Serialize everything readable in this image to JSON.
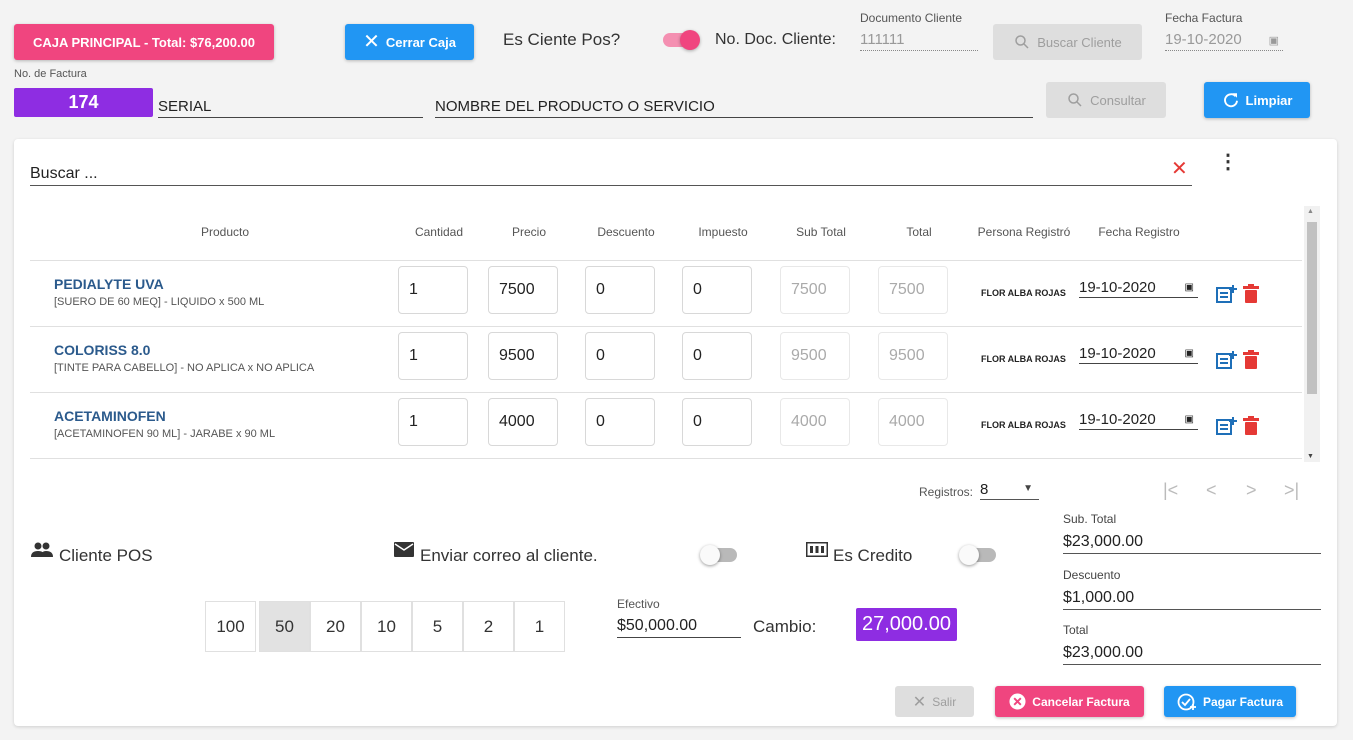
{
  "header": {
    "caja_label": "CAJA PRINCIPAL - Total: $76,200.00",
    "cerrar_caja": "Cerrar Caja",
    "es_cliente_pos": "Es Ciente Pos?",
    "no_doc_cliente": "No. Doc. Cliente:",
    "documento_cliente_label": "Documento Cliente",
    "documento_cliente_value": "111111",
    "buscar_cliente": "Buscar Cliente",
    "fecha_factura_label": "Fecha Factura",
    "fecha_factura_value": "19-10-2020",
    "no_factura_label": "No. de Factura",
    "no_factura_value": "174",
    "serial_placeholder": "SERIAL",
    "producto_placeholder": "NOMBRE DEL PRODUCTO O SERVICIO",
    "consultar": "Consultar",
    "limpiar": "Limpiar"
  },
  "table": {
    "search_placeholder": "Buscar ...",
    "columns": [
      "Producto",
      "Cantidad",
      "Precio",
      "Descuento",
      "Impuesto",
      "Sub Total",
      "Total",
      "Persona Registró",
      "Fecha Registro"
    ],
    "rows": [
      {
        "name": "PEDIALYTE UVA",
        "desc": "[SUERO DE 60 MEQ] - LIQUIDO x 500 ML",
        "cantidad": "1",
        "precio": "7500",
        "descuento": "0",
        "impuesto": "0",
        "subtotal": "7500",
        "total": "7500",
        "persona": "FLOR ALBA ROJAS",
        "fecha": "19-10-2020"
      },
      {
        "name": "COLORISS 8.0",
        "desc": "[TINTE PARA CABELLO] - NO APLICA x NO APLICA",
        "cantidad": "1",
        "precio": "9500",
        "descuento": "0",
        "impuesto": "0",
        "subtotal": "9500",
        "total": "9500",
        "persona": "FLOR ALBA ROJAS",
        "fecha": "19-10-2020"
      },
      {
        "name": "ACETAMINOFEN",
        "desc": "[ACETAMINOFEN 90 ML] - JARABE x 90 ML",
        "cantidad": "1",
        "precio": "4000",
        "descuento": "0",
        "impuesto": "0",
        "subtotal": "4000",
        "total": "4000",
        "persona": "FLOR ALBA ROJAS",
        "fecha": "19-10-2020"
      }
    ],
    "registros_label": "Registros:",
    "registros_value": "8"
  },
  "footer": {
    "cliente_pos": "Cliente POS",
    "enviar_correo": "Enviar correo al cliente.",
    "es_credito": "Es Credito",
    "coins": [
      "100",
      "50",
      "20",
      "10",
      "5",
      "2",
      "1"
    ],
    "efectivo_label": "Efectivo",
    "efectivo_value": "$50,000.00",
    "cambio_label": "Cambio:",
    "cambio_value": "27,000.00",
    "subtotal_label": "Sub. Total",
    "subtotal_value": "$23,000.00",
    "descuento_label": "Descuento",
    "descuento_value": "$1,000.00",
    "total_label": "Total",
    "total_value": "$23,000.00",
    "salir": "Salir",
    "cancelar_factura": "Cancelar Factura",
    "pagar_factura": "Pagar Factura"
  },
  "colors": {
    "pink": "#f0457f",
    "blue": "#2196f3",
    "purple": "#8e2de2",
    "red": "#e53935"
  },
  "toggles": {
    "es_cliente_pos": true,
    "enviar_correo": false,
    "es_credito": false
  }
}
